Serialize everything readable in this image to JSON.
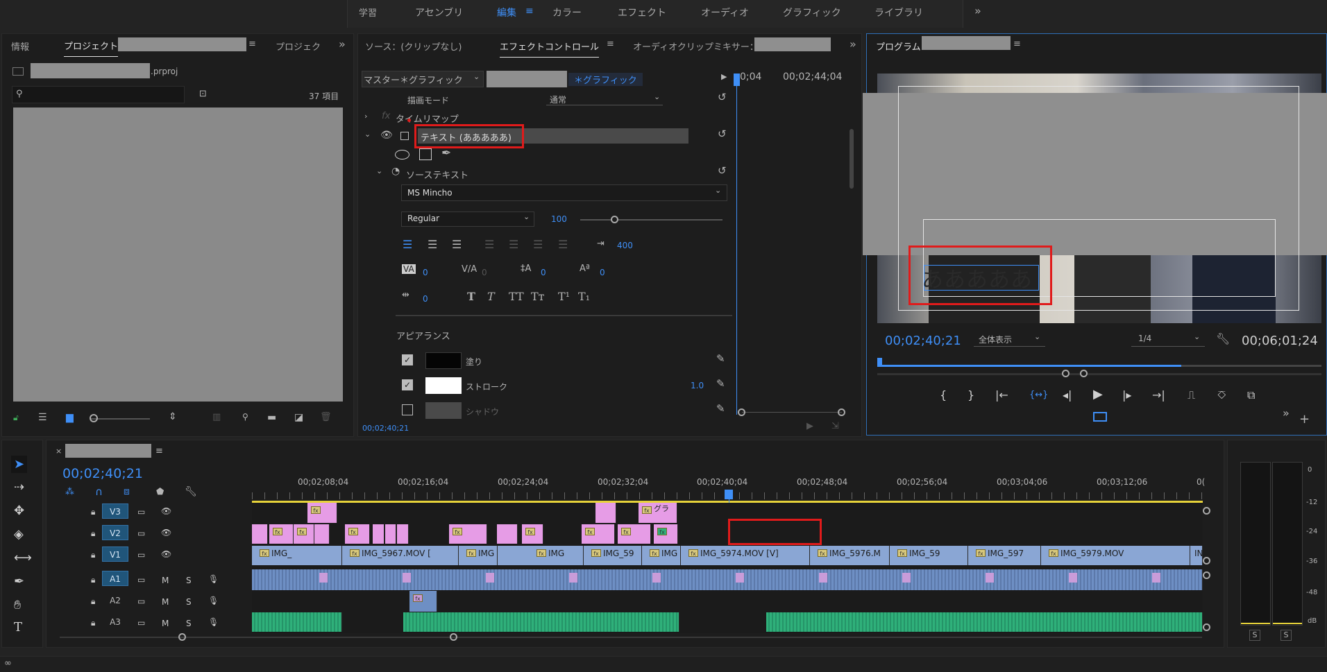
{
  "workspaces": [
    "学習",
    "アセンブリ",
    "編集",
    "カラー",
    "エフェクト",
    "オーディオ",
    "グラフィック",
    "ライブラリ"
  ],
  "workspace_active": "編集",
  "project_panel": {
    "tab_info": "情報",
    "tab_project": "プロジェクト",
    "tab_project2": "プロジェク",
    "filename_suffix": ".prproj",
    "item_count": "37 項目"
  },
  "effect_panel": {
    "tab_source": "ソース：(クリップなし)",
    "tab_effect_controls": "エフェクトコントロール",
    "tab_audio_mixer": "オーディオクリップミキサー：",
    "master_label": "マスター＊グラフィック",
    "clip_label": "＊グラフィック",
    "ruler_start": "0;04",
    "ruler_end": "00;02;44;04",
    "blend_mode_label": "描画モード",
    "blend_mode_value": "通常",
    "time_remap": "タイムリマップ",
    "text_layer": "テキスト (あああああ)",
    "source_text": "ソーステキスト",
    "font": "MS Mincho",
    "font_style": "Regular",
    "font_size": "100",
    "tracking": "400",
    "kerning": "0",
    "tsume": "0",
    "leading": "0",
    "baseline": "0",
    "tsume2": "0",
    "appearance": "アピアランス",
    "fill": "塗り",
    "stroke": "ストローク",
    "stroke_width": "1.0",
    "shadow": "シャドウ",
    "timecode": "00;02;40;21"
  },
  "program_monitor": {
    "tab": "プログラム",
    "timecode_current": "00;02;40;21",
    "fit": "全体表示",
    "resolution": "1/4",
    "timecode_duration": "00;06;01;24",
    "overlay_text": "あああああ"
  },
  "timeline": {
    "timecode": "00;02;40;21",
    "ruler": [
      "00;02;08;04",
      "00;02;16;04",
      "00;02;24;04",
      "00;02;32;04",
      "00;02;40;04",
      "00;02;48;04",
      "00;02;56;04",
      "00;03;04;06",
      "00;03;12;06",
      "0("
    ],
    "tracks": [
      "V3",
      "V2",
      "V1",
      "A1",
      "A2",
      "A3"
    ],
    "v1_clips": [
      "IMG_",
      "IMG_5967.MOV [",
      "IMG",
      "IMG",
      "IMG_59",
      "IMG",
      "IMG_5974.MOV [V]",
      "IMG_5976.M",
      "IMG_59",
      "IMG_597",
      "IMG_5979.MOV",
      "IN"
    ],
    "v3_clip_text": "グラ",
    "audio_letters": [
      "M",
      "S"
    ]
  },
  "meter": {
    "scale": [
      "0",
      "-12",
      "-24",
      "-36",
      "-48",
      "dB"
    ],
    "solo": [
      "S",
      "S"
    ]
  }
}
